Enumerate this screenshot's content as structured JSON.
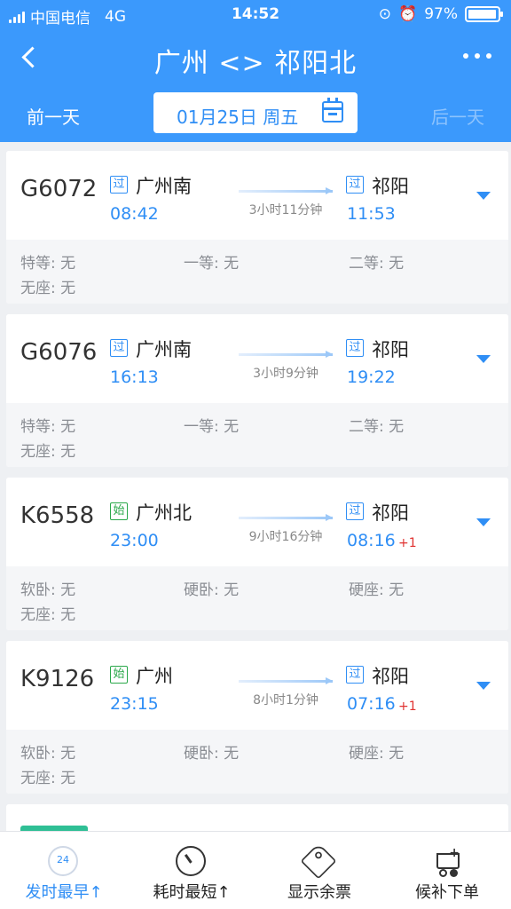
{
  "status_bar": {
    "carrier": "中国电信",
    "network": "4G",
    "time": "14:52",
    "battery": "97%"
  },
  "nav": {
    "title": "广州 <> 祁阳北"
  },
  "date_bar": {
    "prev_label": "前一天",
    "date": "01月25日 周五",
    "next_label": "后一天"
  },
  "trains": [
    {
      "number": "G6072",
      "dep_tag": "过",
      "dep_station": "广州南",
      "dep_time": "08:42",
      "duration": "3小时11分钟",
      "arr_tag": "过",
      "arr_station": "祁阳",
      "arr_time": "11:53",
      "plus_day": "",
      "seats": [
        "特等: 无",
        "一等: 无",
        "二等: 无",
        "无座: 无"
      ]
    },
    {
      "number": "G6076",
      "dep_tag": "过",
      "dep_station": "广州南",
      "dep_time": "16:13",
      "duration": "3小时9分钟",
      "arr_tag": "过",
      "arr_station": "祁阳",
      "arr_time": "19:22",
      "plus_day": "",
      "seats": [
        "特等: 无",
        "一等: 无",
        "二等: 无",
        "无座: 无"
      ]
    },
    {
      "number": "K6558",
      "dep_tag": "始",
      "dep_station": "广州北",
      "dep_time": "23:00",
      "duration": "9小时16分钟",
      "arr_tag": "过",
      "arr_station": "祁阳",
      "arr_time": "08:16",
      "plus_day": "+1",
      "seats": [
        "软卧: 无",
        "硬卧: 无",
        "硬座: 无",
        "无座: 无"
      ]
    },
    {
      "number": "K9126",
      "dep_tag": "始",
      "dep_station": "广州",
      "dep_time": "23:15",
      "duration": "8小时1分钟",
      "arr_tag": "过",
      "arr_station": "祁阳",
      "arr_time": "07:16",
      "plus_day": "+1",
      "seats": [
        "软卧: 无",
        "硬卧: 无",
        "硬座: 无",
        "无座: 无"
      ]
    }
  ],
  "tabs": [
    {
      "label": "发时最早↑",
      "icon": "clock-24-icon",
      "icon_text": "24"
    },
    {
      "label": "耗时最短↑",
      "icon": "timer-icon"
    },
    {
      "label": "显示余票",
      "icon": "ticket-tag-icon"
    },
    {
      "label": "候补下单",
      "icon": "cart-icon",
      "icon_text": "+"
    }
  ],
  "colors": {
    "header_blue": "#3b99fc",
    "accent_blue": "#2f8ef5",
    "start_green": "#2aa84a",
    "plus_day_red": "#e0312f"
  }
}
